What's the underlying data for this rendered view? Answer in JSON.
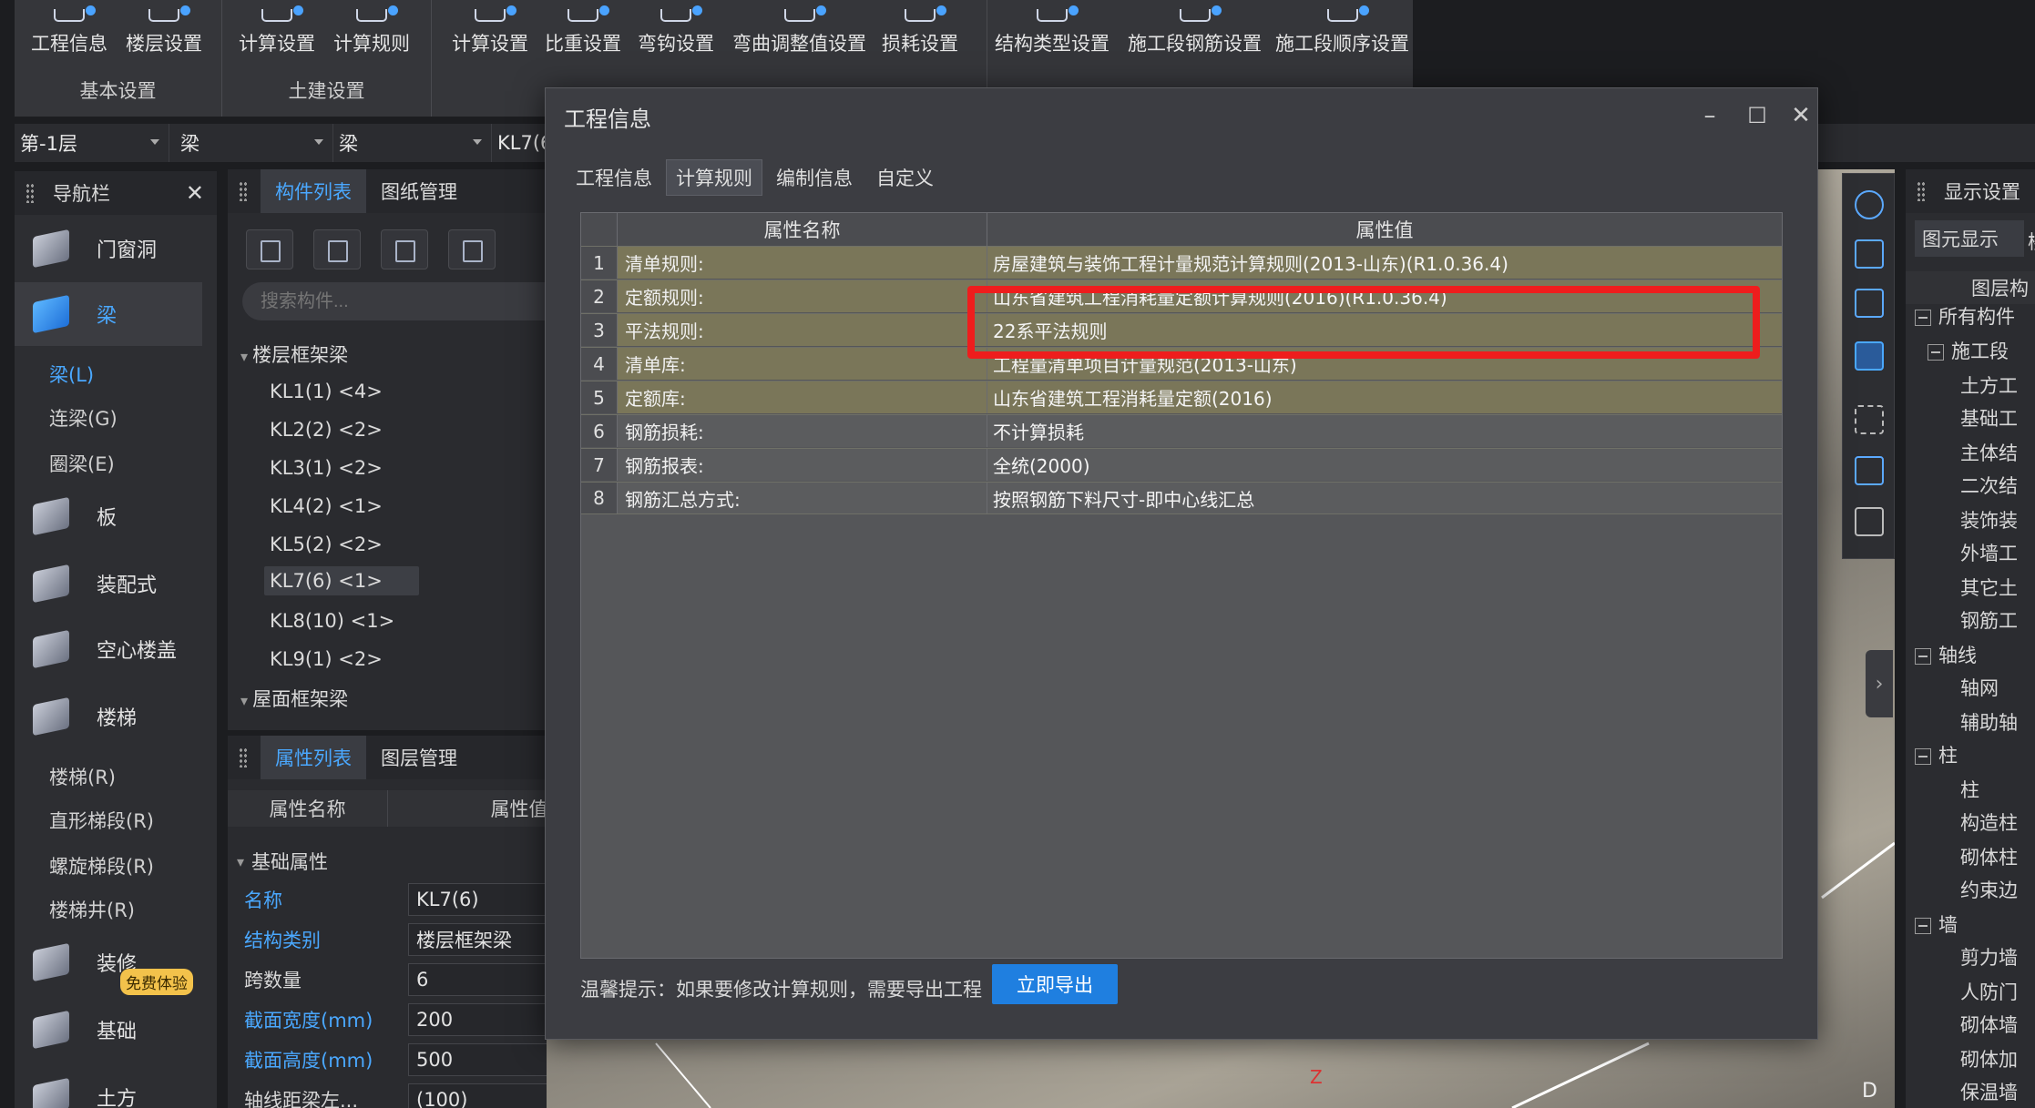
{
  "ribbon": {
    "groups": [
      {
        "label": "基本设置",
        "buttons": [
          "工程信息",
          "楼层设置"
        ]
      },
      {
        "label": "土建设置",
        "buttons": [
          "计算设置",
          "计算规则"
        ]
      },
      {
        "label": "",
        "buttons": [
          "计算设置",
          "比重设置",
          "弯钩设置",
          "弯曲调整值设置",
          "损耗设置"
        ]
      },
      {
        "label": "",
        "buttons": [
          "结构类型设置",
          "施工段钢筋设置",
          "施工段顺序设置"
        ]
      }
    ]
  },
  "selectors": {
    "floor": "第-1层",
    "type1": "梁",
    "type2": "梁",
    "component": "KL7(6"
  },
  "nav": {
    "title": "导航栏",
    "items": [
      "门窗洞",
      "梁",
      "板",
      "装配式",
      "空心楼盖",
      "楼梯",
      "装修",
      "基础",
      "土方"
    ],
    "beam_sub": [
      "梁(L)",
      "连梁(G)",
      "圈梁(E)"
    ],
    "stair_sub": [
      "楼梯(R)",
      "直形梯段(R)",
      "螺旋梯段(R)",
      "楼梯井(R)"
    ],
    "badge": "免费体验"
  },
  "complist": {
    "tabs": [
      "构件列表",
      "图纸管理"
    ],
    "search_placeholder": "搜索构件...",
    "group1": "楼层框架梁",
    "items": [
      "KL1(1) <4>",
      "KL2(2) <2>",
      "KL3(1) <2>",
      "KL4(2) <1>",
      "KL5(2) <2>",
      "KL7(6) <1>",
      "KL8(10) <1>",
      "KL9(1) <2>"
    ],
    "group2": "屋面框架梁"
  },
  "proplist": {
    "tabs": [
      "属性列表",
      "图层管理"
    ],
    "col_name": "属性名称",
    "col_value": "属性值",
    "section": "基础属性",
    "rows": [
      {
        "k": "名称",
        "v": "KL7(6)"
      },
      {
        "k": "结构类别",
        "v": "楼层框架梁"
      },
      {
        "k": "跨数量",
        "v": "6"
      },
      {
        "k": "截面宽度(mm)",
        "v": "200"
      },
      {
        "k": "截面高度(mm)",
        "v": "500"
      },
      {
        "k": "轴线距梁左...",
        "v": "(100)"
      }
    ]
  },
  "display": {
    "title": "显示设置",
    "tab": "图元显示",
    "tab2": "楼",
    "header": "图层构",
    "items": [
      "所有构件",
      "施工段",
      "土方工",
      "基础工",
      "主体结",
      "二次结",
      "装饰装",
      "外墙工",
      "其它土",
      "钢筋工",
      "轴线",
      "轴网",
      "辅助轴",
      "柱",
      "柱",
      "构造柱",
      "砌体柱",
      "约束边",
      "墙",
      "剪力墙",
      "人防门",
      "砌体墙",
      "砌体加",
      "保温墙"
    ]
  },
  "dialog": {
    "title": "工程信息",
    "tabs": [
      "工程信息",
      "计算规则",
      "编制信息",
      "自定义"
    ],
    "col_name": "属性名称",
    "col_value": "属性值",
    "rows": [
      {
        "n": "1",
        "k": "清单规则:",
        "v": "房屋建筑与装饰工程计量规范计算规则(2013-山东)(R1.0.36.4)"
      },
      {
        "n": "2",
        "k": "定额规则:",
        "v": "山东省建筑工程消耗量定额计算规则(2016)(R1.0.36.4)"
      },
      {
        "n": "3",
        "k": "平法规则:",
        "v": "22系平法规则"
      },
      {
        "n": "4",
        "k": "清单库:",
        "v": "工程量清单项目计量规范(2013-山东)"
      },
      {
        "n": "5",
        "k": "定额库:",
        "v": "山东省建筑工程消耗量定额(2016)"
      },
      {
        "n": "6",
        "k": "钢筋损耗:",
        "v": "不计算损耗"
      },
      {
        "n": "7",
        "k": "钢筋报表:",
        "v": "全统(2000)"
      },
      {
        "n": "8",
        "k": "钢筋汇总方式:",
        "v": "按照钢筋下料尺寸-即中心线汇总"
      }
    ],
    "tip": "温馨提示：如果要修改计算规则，需要导出工程",
    "export_label": "立即导出"
  },
  "colors": {
    "accent": "#1f7fe0",
    "highlight": "#ee1d1d",
    "olive_row": "#7a7659"
  }
}
